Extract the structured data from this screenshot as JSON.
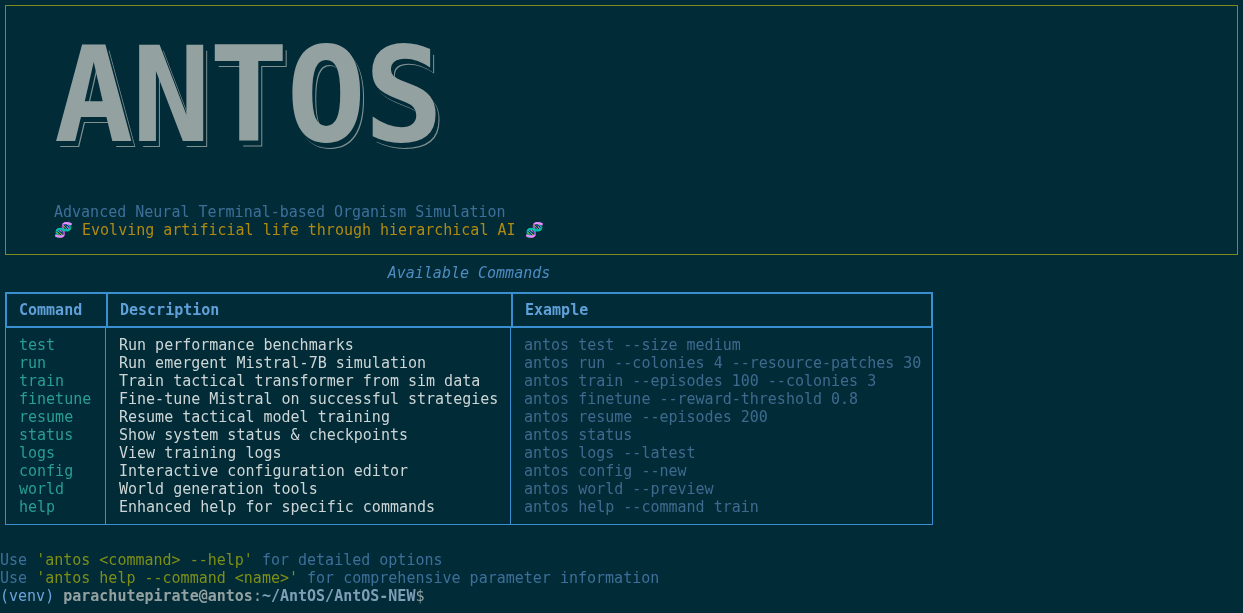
{
  "banner": {
    "logo": "ANTOS",
    "subtitle": "Advanced Neural Terminal-based Organism Simulation",
    "tagline": "🧬 Evolving artificial life through hierarchical AI 🧬"
  },
  "table": {
    "title": "Available Commands",
    "columns": [
      "Command",
      "Description",
      "Example"
    ],
    "rows": [
      {
        "command": "test",
        "description": "Run performance benchmarks",
        "example": "antos test --size medium"
      },
      {
        "command": "run",
        "description": "Run emergent Mistral-7B simulation",
        "example": "antos run --colonies 4 --resource-patches 30"
      },
      {
        "command": "train",
        "description": "Train tactical transformer from sim data",
        "example": "antos train --episodes 100 --colonies 3"
      },
      {
        "command": "finetune",
        "description": "Fine-tune Mistral on successful strategies",
        "example": "antos finetune --reward-threshold 0.8"
      },
      {
        "command": "resume",
        "description": "Resume tactical model training",
        "example": "antos resume --episodes 200"
      },
      {
        "command": "status",
        "description": "Show system status & checkpoints",
        "example": "antos status"
      },
      {
        "command": "logs",
        "description": "View training logs",
        "example": "antos logs --latest"
      },
      {
        "command": "config",
        "description": "Interactive configuration editor",
        "example": "antos config --new"
      },
      {
        "command": "world",
        "description": "World generation tools",
        "example": "antos world --preview"
      },
      {
        "command": "help",
        "description": "Enhanced help for specific commands",
        "example": "antos help --command train"
      }
    ]
  },
  "hints": [
    {
      "prefix": "Use",
      "quoted": "'antos <command> --help'",
      "suffix": "for detailed options"
    },
    {
      "prefix": "Use",
      "quoted": "'antos help --command <name>'",
      "suffix": "for comprehensive parameter information"
    }
  ],
  "prompt": {
    "venv": "(venv)",
    "user_host": "parachutepirate@antos",
    "separator": ":",
    "path": "~/AntOS/AntOS-NEW",
    "symbol": "$"
  }
}
